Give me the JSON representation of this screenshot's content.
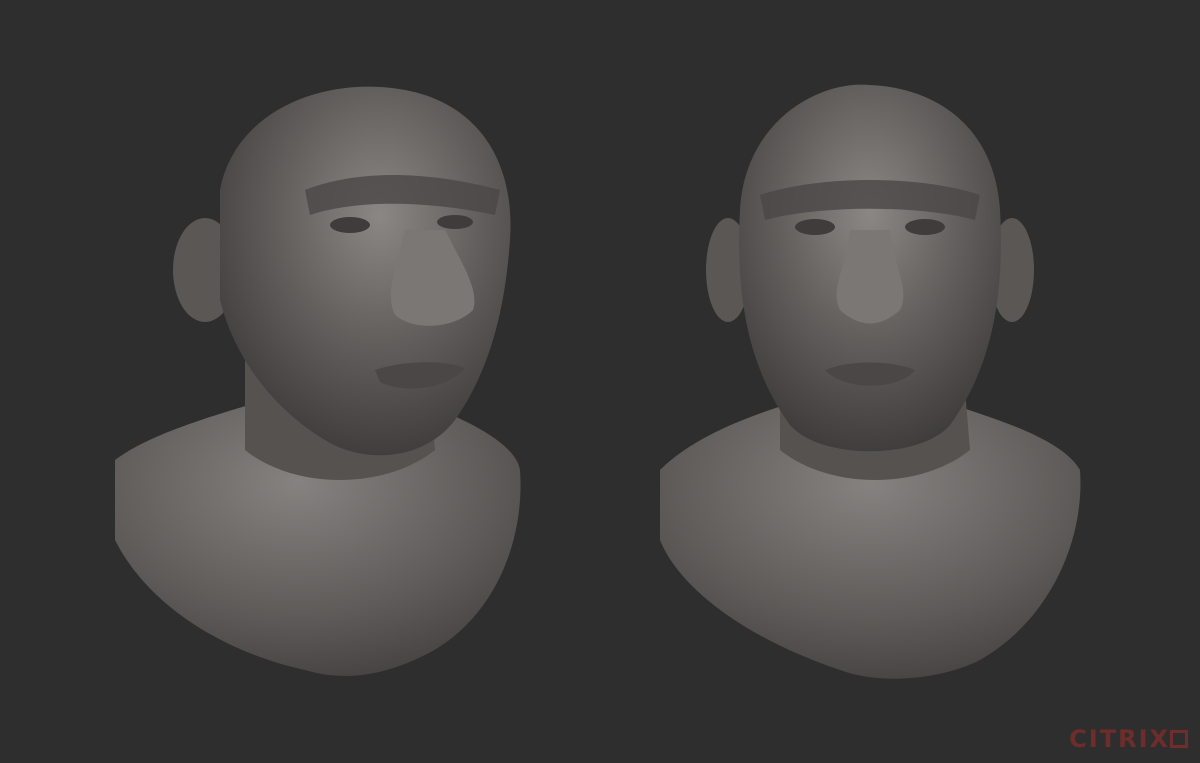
{
  "watermark": {
    "text": "CITRIX",
    "color": "#7a2d2a"
  },
  "scene": {
    "background_color": "#2e2e2f",
    "sculpt_color": "#6b6866",
    "subject": "sculpted-neanderthal-bust",
    "views": [
      "three-quarter",
      "front"
    ]
  }
}
